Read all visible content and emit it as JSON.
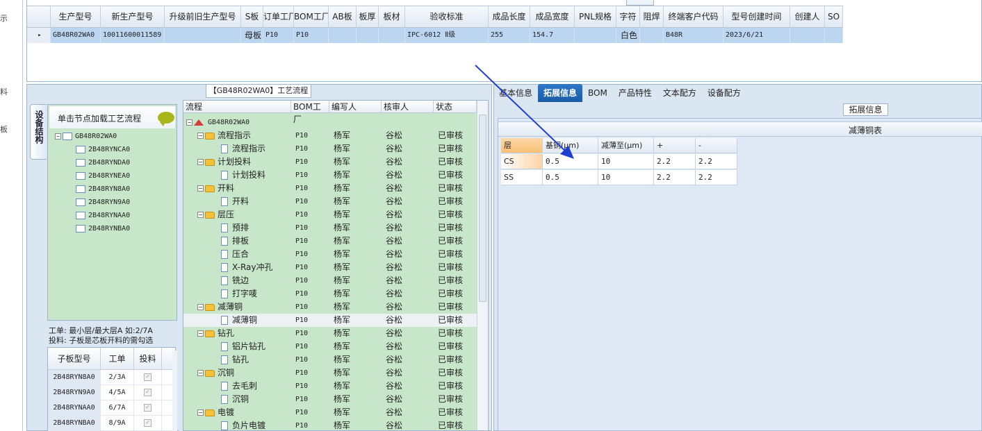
{
  "left_strip": {
    "chars": [
      "示",
      "料",
      "板"
    ]
  },
  "top_grid": {
    "columns": [
      "生产型号",
      "新生产型号",
      "升级前旧生产型号",
      "S板",
      "订单工厂",
      "BOM工厂",
      "AB板",
      "板厚",
      "板材",
      "验收标准",
      "成品长度",
      "成品宽度",
      "PNL规格",
      "字符",
      "阻焊",
      "终端客户代码",
      "型号创建时间",
      "创建人",
      "SO"
    ],
    "row": {
      "marker": "▸",
      "生产型号": "GB48R02WA0",
      "新生产型号": "10011600011589",
      "升级前旧生产型号": "",
      "S板": "母板",
      "订单工厂": "P10",
      "BOM工厂": "P10",
      "AB板": "",
      "板厚": "",
      "板材": "",
      "验收标准": "IPC-6012 Ⅱ级",
      "成品长度": "255",
      "成品宽度": "154.7",
      "PNL规格": "",
      "字符": "白色",
      "阻焊": "",
      "终端客户代码": "B48R",
      "型号创建时间": "2023/6/21",
      "创建人": "",
      "SO": ""
    }
  },
  "process_panel": {
    "title": "【GB48R02WA0】工艺流程",
    "vertical_tab": "设备结构",
    "tree_head": "单击节点加载工艺流程",
    "tree_root": "GB48R02WA0",
    "tree_children": [
      "2B48RYNCA0",
      "2B48RYNDA0",
      "2B48RYNEA0",
      "2B48RYN8A0",
      "2B48RYN9A0",
      "2B48RYNAA0",
      "2B48RYNBA0"
    ],
    "note_line1": "工单: 最小层/最大层A 如:2/7A",
    "note_line2": "投料: 子板是芯板开料的需勾选",
    "sub_grid": {
      "columns": [
        "子板型号",
        "工单",
        "投料"
      ],
      "rows": [
        {
          "model": "2B48RYN8A0",
          "order": "2/3A",
          "feed": "✓"
        },
        {
          "model": "2B48RYN9A0",
          "order": "4/5A",
          "feed": "✓"
        },
        {
          "model": "2B48RYNAA0",
          "order": "6/7A",
          "feed": "✓"
        },
        {
          "model": "2B48RYNBA0",
          "order": "8/9A",
          "feed": "✓"
        }
      ]
    }
  },
  "flow_grid": {
    "columns": [
      "流程",
      "BOM工厂",
      "编写人",
      "核审人",
      "状态"
    ],
    "root": "GB48R02WA0",
    "rows": [
      {
        "level": 1,
        "name": "流程指示",
        "bom": "P10",
        "writer": "杨军",
        "reviewer": "谷松",
        "status": "已审核"
      },
      {
        "level": 2,
        "name": "流程指示",
        "bom": "P10",
        "writer": "杨军",
        "reviewer": "谷松",
        "status": "已审核"
      },
      {
        "level": 1,
        "name": "计划投料",
        "bom": "P10",
        "writer": "杨军",
        "reviewer": "谷松",
        "status": "已审核"
      },
      {
        "level": 2,
        "name": "计划投料",
        "bom": "P10",
        "writer": "杨军",
        "reviewer": "谷松",
        "status": "已审核"
      },
      {
        "level": 1,
        "name": "开料",
        "bom": "P10",
        "writer": "杨军",
        "reviewer": "谷松",
        "status": "已审核"
      },
      {
        "level": 2,
        "name": "开料",
        "bom": "P10",
        "writer": "杨军",
        "reviewer": "谷松",
        "status": "已审核"
      },
      {
        "level": 1,
        "name": "层压",
        "bom": "P10",
        "writer": "杨军",
        "reviewer": "谷松",
        "status": "已审核"
      },
      {
        "level": 2,
        "name": "预排",
        "bom": "P10",
        "writer": "杨军",
        "reviewer": "谷松",
        "status": "已审核"
      },
      {
        "level": 2,
        "name": "排板",
        "bom": "P10",
        "writer": "杨军",
        "reviewer": "谷松",
        "status": "已审核"
      },
      {
        "level": 2,
        "name": "压合",
        "bom": "P10",
        "writer": "杨军",
        "reviewer": "谷松",
        "status": "已审核"
      },
      {
        "level": 2,
        "name": "X-Ray冲孔",
        "bom": "P10",
        "writer": "杨军",
        "reviewer": "谷松",
        "status": "已审核"
      },
      {
        "level": 2,
        "name": "铣边",
        "bom": "P10",
        "writer": "杨军",
        "reviewer": "谷松",
        "status": "已审核"
      },
      {
        "level": 2,
        "name": "打字唛",
        "bom": "P10",
        "writer": "杨军",
        "reviewer": "谷松",
        "status": "已审核"
      },
      {
        "level": 1,
        "name": "减薄铜",
        "bom": "P10",
        "writer": "杨军",
        "reviewer": "谷松",
        "status": "已审核"
      },
      {
        "level": 2,
        "name": "减薄铜",
        "bom": "P10",
        "writer": "杨军",
        "reviewer": "谷松",
        "status": "已审核",
        "selected": true
      },
      {
        "level": 1,
        "name": "钻孔",
        "bom": "P10",
        "writer": "杨军",
        "reviewer": "谷松",
        "status": "已审核"
      },
      {
        "level": 2,
        "name": "铝片钻孔",
        "bom": "P10",
        "writer": "杨军",
        "reviewer": "谷松",
        "status": "已审核"
      },
      {
        "level": 2,
        "name": "钻孔",
        "bom": "P10",
        "writer": "杨军",
        "reviewer": "谷松",
        "status": "已审核"
      },
      {
        "level": 1,
        "name": "沉铜",
        "bom": "P10",
        "writer": "杨军",
        "reviewer": "谷松",
        "status": "已审核"
      },
      {
        "level": 2,
        "name": "去毛刺",
        "bom": "P10",
        "writer": "杨军",
        "reviewer": "谷松",
        "status": "已审核"
      },
      {
        "level": 2,
        "name": "沉铜",
        "bom": "P10",
        "writer": "杨军",
        "reviewer": "谷松",
        "status": "已审核"
      },
      {
        "level": 1,
        "name": "电镀",
        "bom": "P10",
        "writer": "杨军",
        "reviewer": "谷松",
        "status": "已审核"
      },
      {
        "level": 2,
        "name": "负片电镀",
        "bom": "P10",
        "writer": "杨军",
        "reviewer": "谷松",
        "status": "已审核"
      }
    ]
  },
  "right_panel": {
    "tabs": [
      "基本信息",
      "拓展信息",
      "BOM",
      "产品特性",
      "文本配方",
      "设备配方"
    ],
    "active_tab": "拓展信息",
    "group_title": "拓展信息",
    "table_title": "减薄铜表",
    "table_columns": [
      "层",
      "基铜(μm)",
      "减薄至(μm)",
      "+",
      "-"
    ],
    "table_rows": [
      [
        "CS",
        "0.5",
        "10",
        "2.2",
        "2.2"
      ],
      [
        "SS",
        "0.5",
        "10",
        "2.2",
        "2.2"
      ]
    ]
  },
  "colors": {
    "accent": "#1a5ca8",
    "tree_bg": "#c8e6c9",
    "selected_row": "#bcd6f2",
    "panel_bg": "#dbe6f3",
    "arrow": "#1f3fd0"
  }
}
